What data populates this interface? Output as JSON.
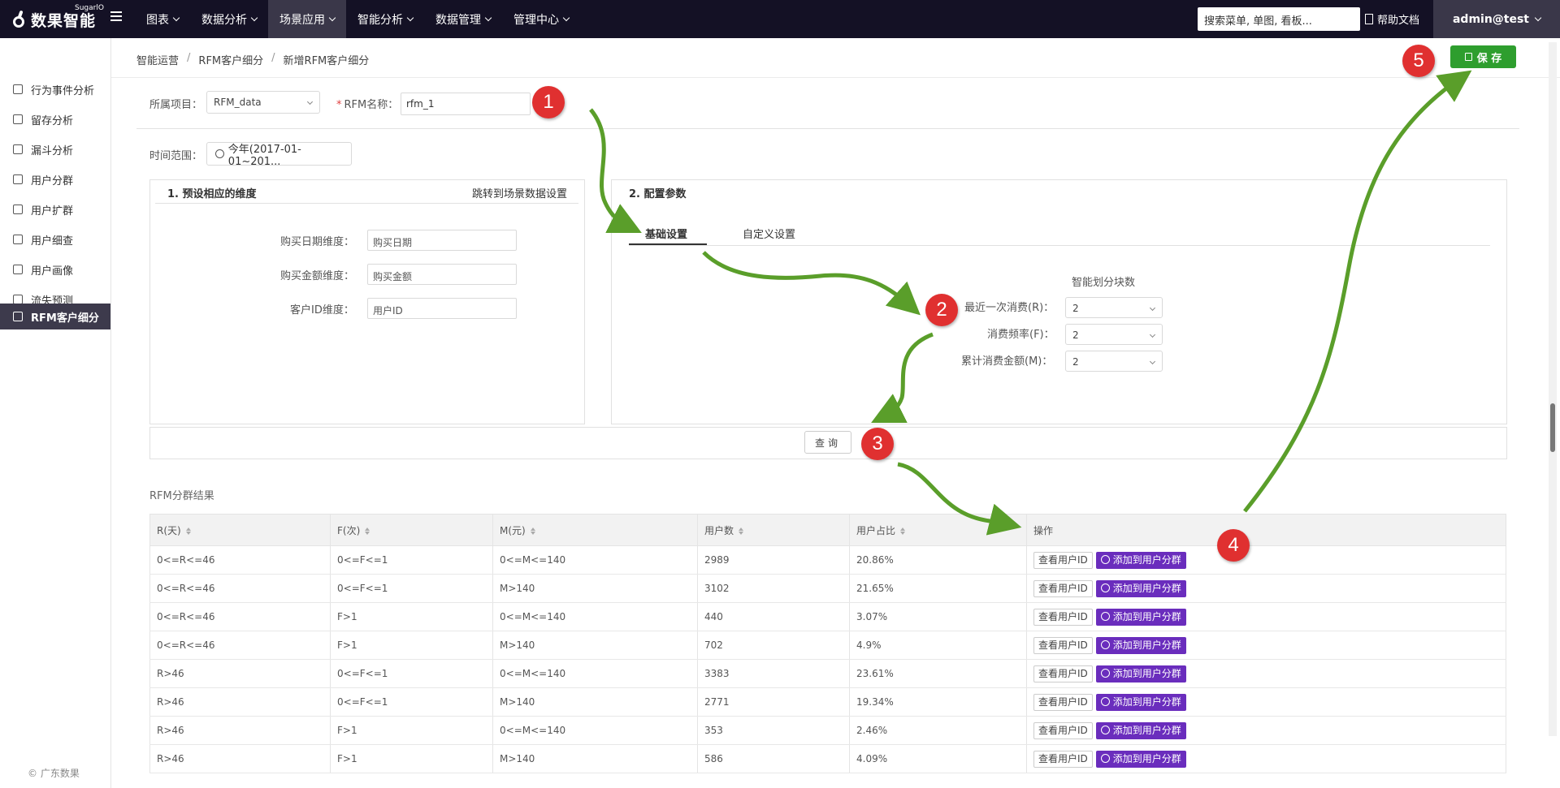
{
  "topnav": {
    "logo_text": "数果智能",
    "logo_sup": "SugarlO",
    "menu": [
      {
        "label": "图表"
      },
      {
        "label": "数据分析"
      },
      {
        "label": "场景应用"
      },
      {
        "label": "智能分析"
      },
      {
        "label": "数据管理"
      },
      {
        "label": "管理中心"
      }
    ],
    "search_placeholder": "搜索菜单, 单图, 看板...",
    "help_label": "帮助文档",
    "user_label": "admin@test"
  },
  "sidebar": {
    "items": [
      {
        "label": "行为事件分析"
      },
      {
        "label": "留存分析"
      },
      {
        "label": "漏斗分析"
      },
      {
        "label": "用户分群"
      },
      {
        "label": "用户扩群"
      },
      {
        "label": "用户细查"
      },
      {
        "label": "用户画像"
      },
      {
        "label": "流失预测"
      },
      {
        "label": "RFM客户细分"
      }
    ],
    "footer": "© 广东数果"
  },
  "breadcrumb": [
    "智能运营",
    "RFM客户细分",
    "新增RFM客户细分"
  ],
  "save_label": "保 存",
  "form": {
    "project_label": "所属项目：",
    "project_value": "RFM_data",
    "name_required": "*",
    "name_label": "RFM名称：",
    "name_value": "rfm_1",
    "time_label": "时间范围：",
    "time_value": "今年(2017-01-01~201..."
  },
  "left_panel": {
    "title": "1. 预设相应的维度",
    "link": "跳转到场景数据设置",
    "fields": [
      {
        "label": "购买日期维度：",
        "value": "购买日期"
      },
      {
        "label": "购买金额维度：",
        "value": "购买金额"
      },
      {
        "label": "客户ID维度：",
        "value": "用户ID"
      }
    ]
  },
  "right_panel": {
    "title": "2. 配置参数",
    "tabs": [
      "基础设置",
      "自定义设置"
    ],
    "blocks_header": "智能划分块数",
    "params": [
      {
        "label": "最近一次消费(R)：",
        "value": "2"
      },
      {
        "label": "消费频率(F)：",
        "value": "2"
      },
      {
        "label": "累计消费金额(M)：",
        "value": "2"
      }
    ]
  },
  "query_label": "查询",
  "results": {
    "title": "RFM分群结果",
    "columns": [
      "R(天)",
      "F(次)",
      "M(元)",
      "用户数",
      "用户占比",
      "操作"
    ],
    "view_label": "查看用户ID",
    "add_label": "添加到用户分群",
    "rows": [
      [
        "0<=R<=46",
        "0<=F<=1",
        "0<=M<=140",
        "2989",
        "20.86%"
      ],
      [
        "0<=R<=46",
        "0<=F<=1",
        "M>140",
        "3102",
        "21.65%"
      ],
      [
        "0<=R<=46",
        "F>1",
        "0<=M<=140",
        "440",
        "3.07%"
      ],
      [
        "0<=R<=46",
        "F>1",
        "M>140",
        "702",
        "4.9%"
      ],
      [
        "R>46",
        "0<=F<=1",
        "0<=M<=140",
        "3383",
        "23.61%"
      ],
      [
        "R>46",
        "0<=F<=1",
        "M>140",
        "2771",
        "19.34%"
      ],
      [
        "R>46",
        "F>1",
        "0<=M<=140",
        "353",
        "2.46%"
      ],
      [
        "R>46",
        "F>1",
        "M>140",
        "586",
        "4.09%"
      ]
    ]
  },
  "annotations": [
    "1",
    "2",
    "3",
    "4",
    "5"
  ],
  "colors": {
    "nav_bg": "#141125",
    "save_green": "#2e9e2e",
    "add_purple": "#6a2dbd",
    "arrow_green": "#5a9e2a",
    "badge_red": "#e03030"
  }
}
